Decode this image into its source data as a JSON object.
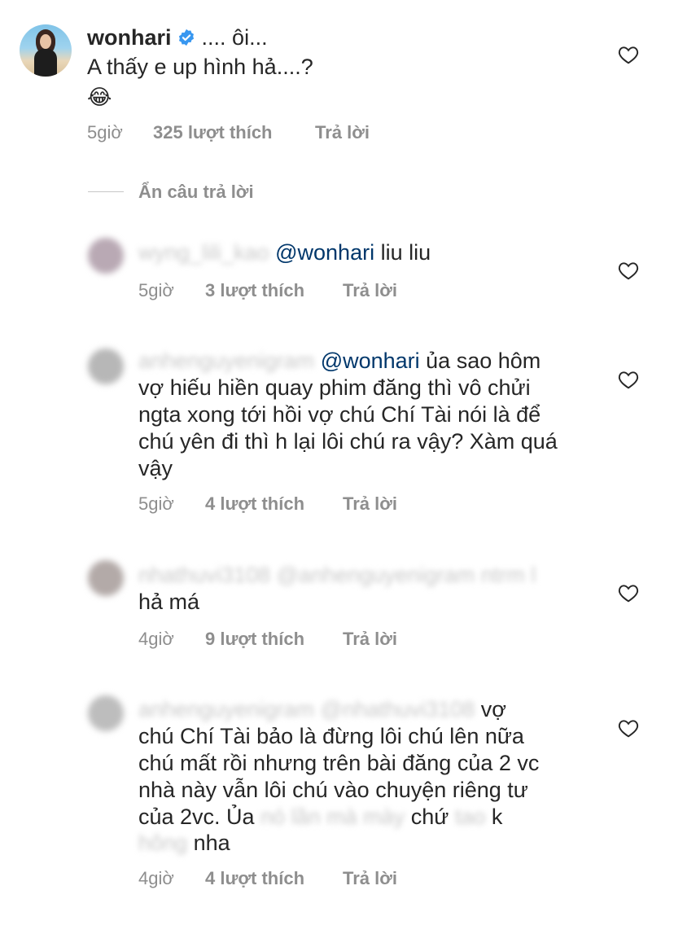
{
  "comments": [
    {
      "username": "wonhari",
      "verified": true,
      "line1": ".... ôi...",
      "line2": "A thấy e up hình hả....?",
      "emoji": "😂",
      "time": "5giờ",
      "likes": "325 lượt thích",
      "reply": "Trả lời"
    }
  ],
  "hide_replies": "Ẩn câu trả lời",
  "replies": [
    {
      "mention": "@wonhari",
      "text": " liu liu",
      "time": "5giờ",
      "likes": "3 lượt thích",
      "reply": "Trả lời"
    },
    {
      "mention": "@wonhari",
      "line1": " ủa sao hôm",
      "lines": [
        "vợ hiếu hiền quay phim đăng thì vô chửi",
        "ngta xong tới hồi vợ chú Chí Tài nói là để",
        "chú yên đi thì h lại lôi chú ra vậy? Xàm quá",
        "vậy"
      ],
      "time": "5giờ",
      "likes": "4 lượt thích",
      "reply": "Trả lời"
    },
    {
      "line2": "hả má",
      "time": "4giờ",
      "likes": "9 lượt thích",
      "reply": "Trả lời"
    },
    {
      "line1": "vợ",
      "line2": "chú Chí Tài bảo là đừng lôi chú lên nữa",
      "line3": "chú mất rồi nhưng trên bài đăng của 2 vc",
      "line4": "nhà này vẫn lôi chú vào chuyện riêng tư",
      "line5a": "của 2vc. Ủa",
      "line5b": "chứ",
      "line5c": "k",
      "line6": "nha",
      "time": "4giờ",
      "likes": "4 lượt thích",
      "reply": "Trả lời"
    }
  ]
}
